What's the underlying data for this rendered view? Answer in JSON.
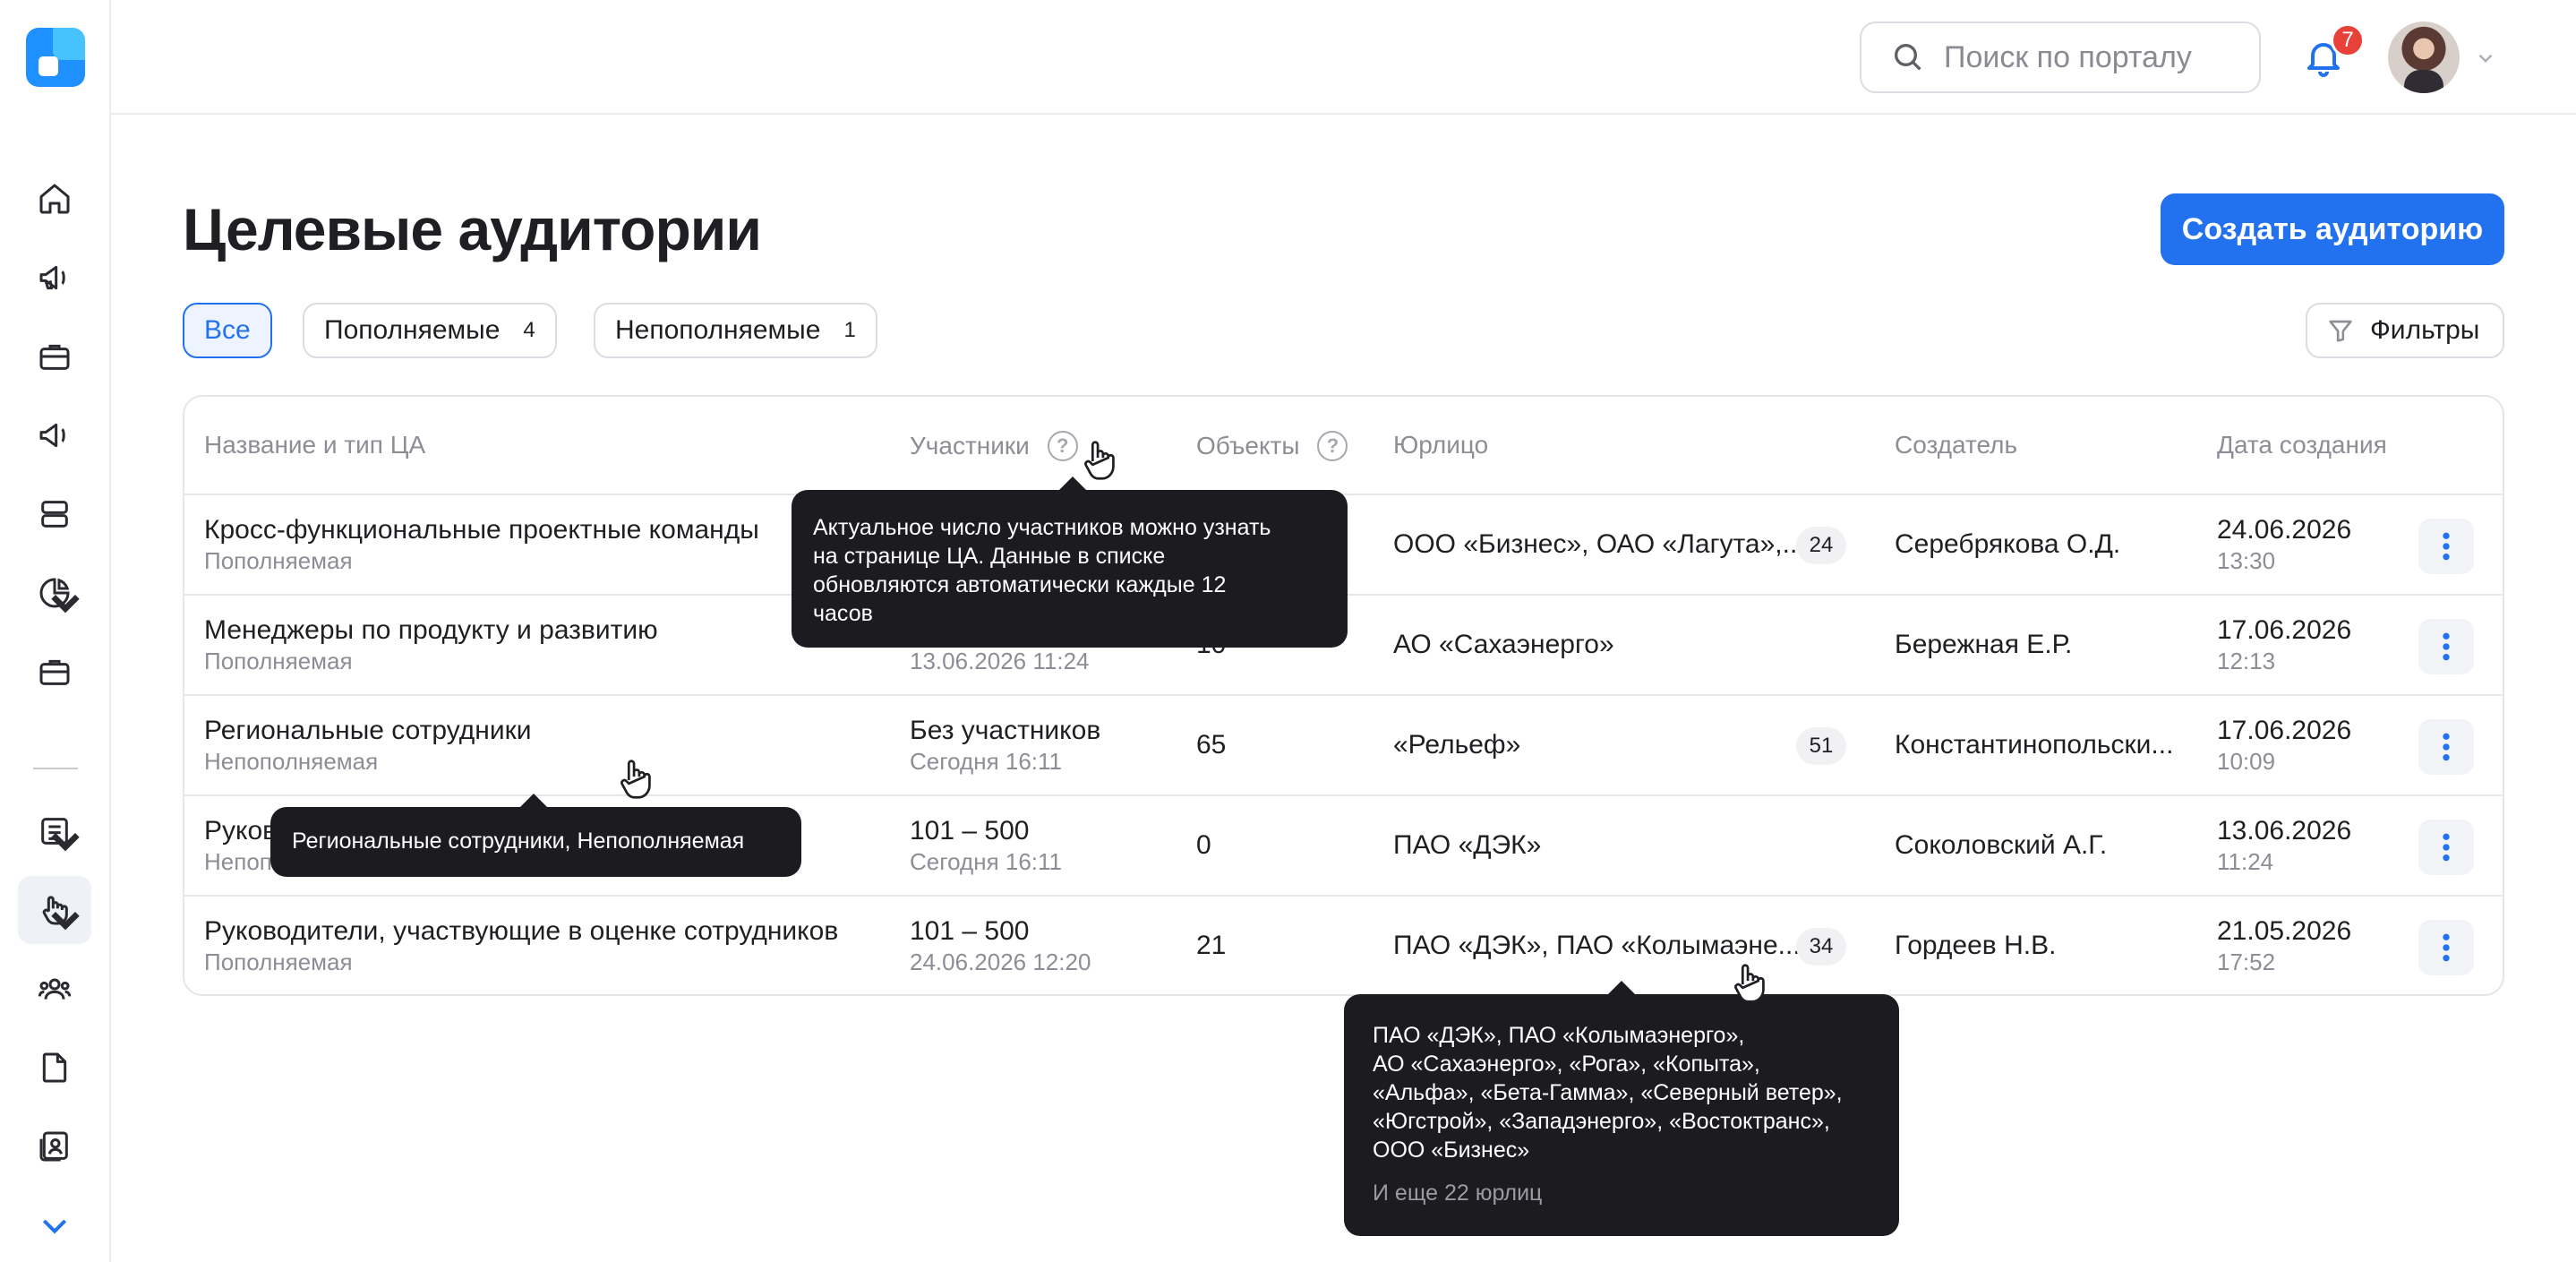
{
  "search": {
    "placeholder": "Поиск по порталу"
  },
  "notifications": {
    "count": "7"
  },
  "page": {
    "title": "Целевые аудитории",
    "create_button": "Создать аудиторию"
  },
  "tabs": [
    {
      "label": "Все",
      "count": ""
    },
    {
      "label": "Пополняемые",
      "count": "4"
    },
    {
      "label": "Непополняемые",
      "count": "1"
    }
  ],
  "filters": {
    "label": "Фильтры"
  },
  "table": {
    "headers": {
      "name": "Название и тип ЦА",
      "participants": "Участники",
      "objects": "Объекты",
      "legal": "Юрлицо",
      "creator": "Создатель",
      "date": "Дата создания"
    },
    "rows": [
      {
        "name": "Кросс-функциональные проектные команды",
        "type": "Пополняемая",
        "participants": "",
        "participants_date": "",
        "objects": "",
        "legal": "ООО «Бизнес», ОАО «Лагута»,...",
        "legal_count": "24",
        "creator": "Серебрякова О.Д.",
        "date": "24.06.2026",
        "time": "13:30"
      },
      {
        "name": "Менеджеры по продукту и развитию",
        "type": "Пополняемая",
        "participants": "",
        "participants_date": "13.06.2026 11:24",
        "objects": "10",
        "legal": "АО «Сахаэнерго»",
        "legal_count": "",
        "creator": "Бережная Е.Р.",
        "date": "17.06.2026",
        "time": "12:13"
      },
      {
        "name": "Региональные сотрудники",
        "type": "Непополняемая",
        "participants": "Без участников",
        "participants_date": "Сегодня 16:11",
        "objects": "65",
        "legal": "«Рельеф»",
        "legal_count": "51",
        "creator": "Константинопольски...",
        "date": "17.06.2026",
        "time": "10:09"
      },
      {
        "name": "Руков",
        "type": "Непоп",
        "participants": "101 – 500",
        "participants_date": "Сегодня 16:11",
        "objects": "0",
        "legal": "ПАО «ДЭК»",
        "legal_count": "",
        "creator": "Соколовский А.Г.",
        "date": "13.06.2026",
        "time": "11:24"
      },
      {
        "name": "Руководители, участвующие в оценке сотрудников",
        "type": "Пополняемая",
        "participants": "101 – 500",
        "participants_date": "24.06.2026 12:20",
        "objects": "21",
        "legal": "ПАО «ДЭК», ПАО «Колымаэне...",
        "legal_count": "34",
        "creator": "Гордеев Н.В.",
        "date": "21.05.2026",
        "time": "17:52"
      }
    ]
  },
  "tooltips": {
    "participants_lines": [
      "Актуальное число участников можно узнать",
      "на странице ЦА. Данные в списке",
      "обновляются автоматически каждые 12",
      "часов"
    ],
    "name": "Региональные сотрудники, Непополняемая",
    "legal_lines": [
      "ПАО «ДЭК», ПАО «Колымаэнерго»,",
      "АО «Сахаэнерго», «Рога», «Копыта»,",
      "«Альфа», «Бета-Гамма», «Северный ветер»,",
      "«Югстрой», «Западэнерго», «Востоктранс»,",
      "ООО «Бизнес»"
    ],
    "legal_more": "И еще 22 юрлиц"
  }
}
